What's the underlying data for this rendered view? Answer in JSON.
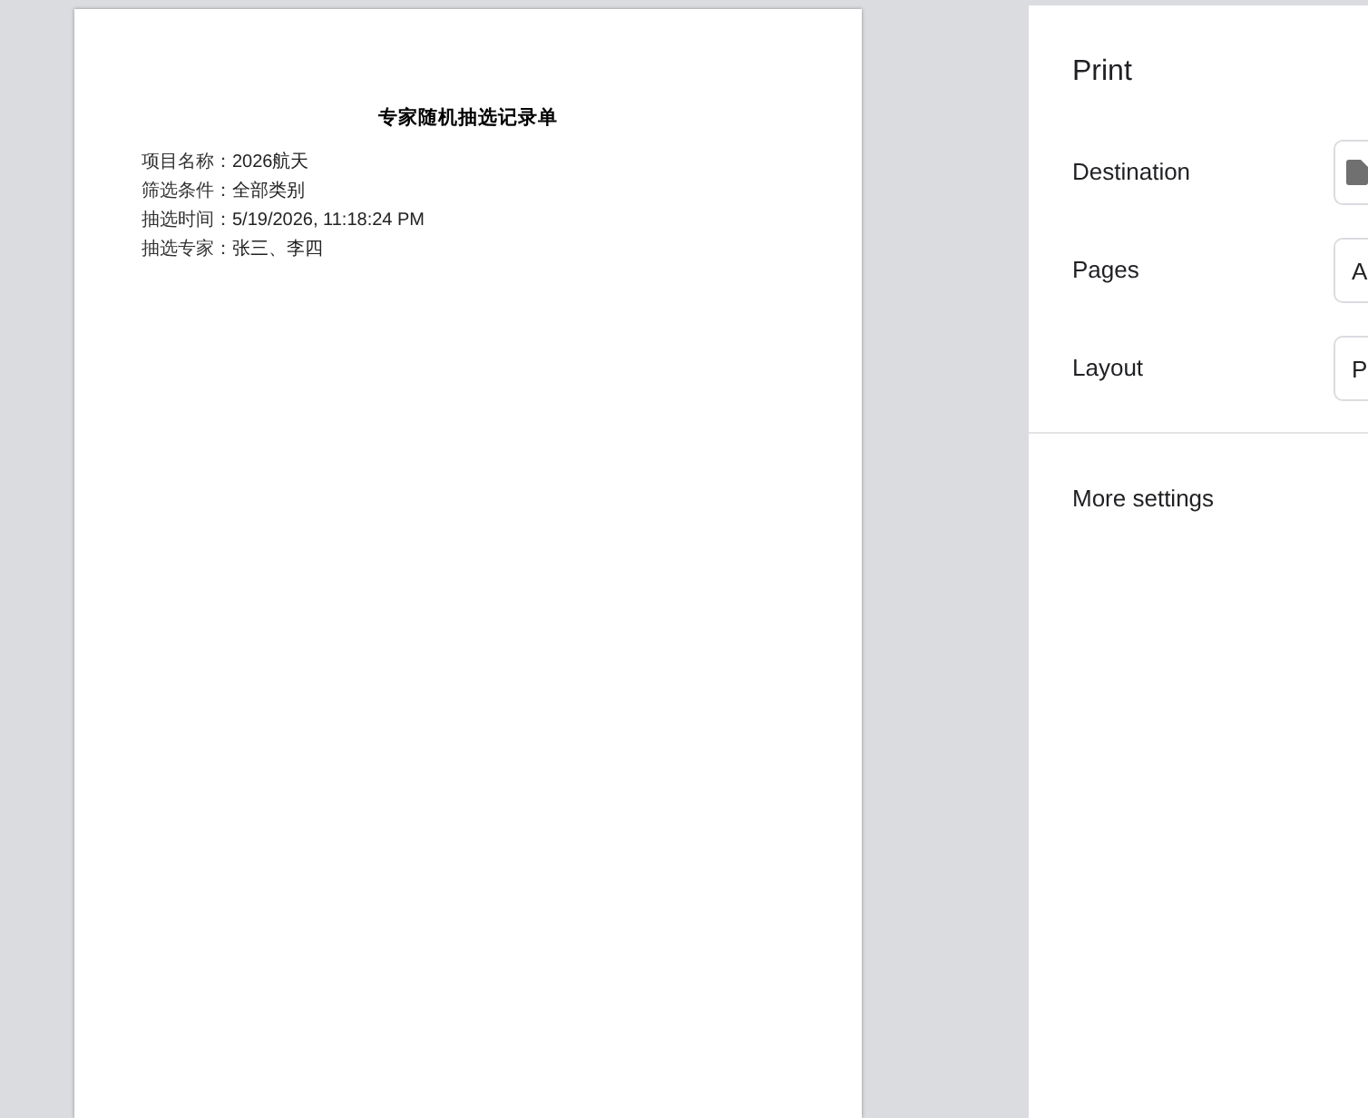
{
  "preview": {
    "page": {
      "title": "专家随机抽选记录单",
      "fields": [
        {
          "label": "项目名称：",
          "value": "2026航天"
        },
        {
          "label": "筛选条件：",
          "value": "全部类别"
        },
        {
          "label": "抽选时间：",
          "value": "5/19/2026, 11:18:24 PM"
        },
        {
          "label": "抽选专家：",
          "value": "张三、李四"
        }
      ]
    }
  },
  "print_panel": {
    "title": "Print",
    "settings": [
      {
        "label": "Destination",
        "kind": "icon"
      },
      {
        "label": "Pages",
        "kind": "text",
        "value": "A"
      },
      {
        "label": "Layout",
        "kind": "text",
        "value": "P"
      }
    ],
    "more_settings": {
      "label": "More settings"
    }
  }
}
